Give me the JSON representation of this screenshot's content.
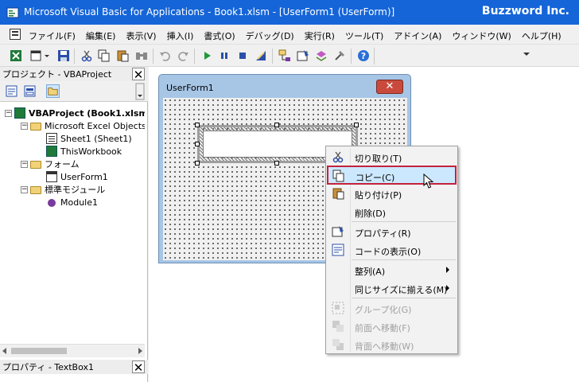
{
  "window": {
    "title": "Microsoft Visual Basic for Applications - Book1.xlsm - [UserForm1 (UserForm)]",
    "brand": "Buzzword Inc."
  },
  "menu": [
    "ファイル(F)",
    "編集(E)",
    "表示(V)",
    "挿入(I)",
    "書式(O)",
    "デバッグ(D)",
    "実行(R)",
    "ツール(T)",
    "アドイン(A)",
    "ウィンドウ(W)",
    "ヘルプ(H)"
  ],
  "toolbar_icons": [
    "excel-icon",
    "insert-userform-icon",
    "save-icon",
    "cut-icon",
    "copy-icon",
    "paste-icon",
    "find-icon",
    "undo-icon",
    "redo-icon",
    "run-icon",
    "break-icon",
    "reset-icon",
    "design-mode-icon",
    "project-explorer-icon",
    "properties-icon",
    "object-browser-icon",
    "toolbox-icon",
    "help-icon"
  ],
  "project_pane": {
    "header": "プロジェクト - VBAProject",
    "tree": [
      {
        "label": "VBAProject (Book1.xlsm)",
        "level": 0,
        "icon": "vbaproject-icon",
        "expander": "−"
      },
      {
        "label": "Microsoft Excel Objects",
        "level": 1,
        "icon": "folder-icon",
        "expander": "−"
      },
      {
        "label": "Sheet1 (Sheet1)",
        "level": 2,
        "icon": "sheet-icon"
      },
      {
        "label": "ThisWorkbook",
        "level": 2,
        "icon": "workbook-icon"
      },
      {
        "label": "フォーム",
        "level": 1,
        "icon": "folder-icon",
        "expander": "−"
      },
      {
        "label": "UserForm1",
        "level": 2,
        "icon": "userform-icon"
      },
      {
        "label": "標準モジュール",
        "level": 1,
        "icon": "folder-icon",
        "expander": "−"
      },
      {
        "label": "Module1",
        "level": 2,
        "icon": "module-icon"
      }
    ]
  },
  "props_pane": {
    "header": "プロパティ - TextBox1"
  },
  "userform": {
    "title": "UserForm1",
    "close_label": "✕"
  },
  "context_menu": {
    "items": [
      {
        "label": "切り取り(T)",
        "icon": "cut-icon",
        "disabled": false,
        "submenu": false
      },
      {
        "label": "コピー(C)",
        "icon": "copy-icon",
        "disabled": false,
        "submenu": false,
        "highlighted": true
      },
      {
        "label": "貼り付け(P)",
        "icon": "paste-icon",
        "disabled": false,
        "submenu": false
      },
      {
        "label": "削除(D)",
        "icon": "",
        "disabled": false,
        "submenu": false
      },
      {
        "label": "プロパティ(R)",
        "icon": "properties-icon",
        "disabled": false,
        "submenu": false
      },
      {
        "label": "コードの表示(O)",
        "icon": "view-code-icon",
        "disabled": false,
        "submenu": false
      },
      {
        "label": "整列(A)",
        "icon": "",
        "disabled": false,
        "submenu": true
      },
      {
        "label": "同じサイズに揃える(M)",
        "icon": "",
        "disabled": false,
        "submenu": true
      },
      {
        "label": "グループ化(G)",
        "icon": "group-icon",
        "disabled": true,
        "submenu": false
      },
      {
        "label": "前面へ移動(F)",
        "icon": "bring-to-front-icon",
        "disabled": true,
        "submenu": false
      },
      {
        "label": "背面へ移動(W)",
        "icon": "send-to-back-icon",
        "disabled": true,
        "submenu": false
      }
    ]
  }
}
